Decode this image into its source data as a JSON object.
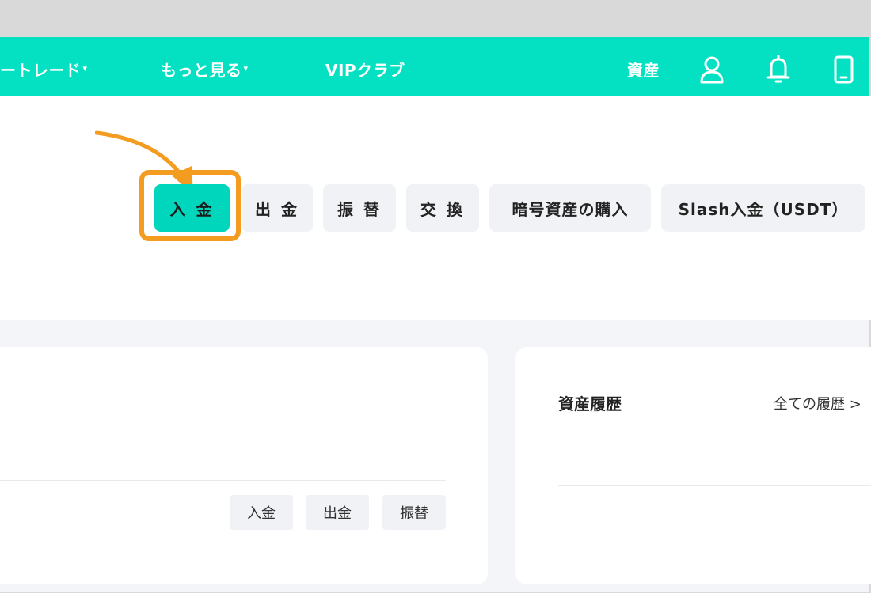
{
  "nav": {
    "items": [
      {
        "label": "ートレード",
        "caret": "▾"
      },
      {
        "label": "もっと見る",
        "caret": "▾"
      },
      {
        "label": "VIPクラブ",
        "caret": ""
      }
    ],
    "assets_label": "資産",
    "icons": [
      "user-icon",
      "bell-icon",
      "phone-icon"
    ]
  },
  "actions": {
    "buttons": [
      "入 金",
      "出 金",
      "振 替",
      "交 換",
      "暗号資産の購入",
      "Slash入金（USDT）"
    ],
    "active_index": 0
  },
  "left_card": {
    "buttons": [
      "入金",
      "出金",
      "振替"
    ]
  },
  "right_card": {
    "title": "資産履歴",
    "link": "全ての履歴 >"
  },
  "colors": {
    "brand": "#03e0c2",
    "active_button": "#00d6bc",
    "highlight": "#f39c1f"
  }
}
